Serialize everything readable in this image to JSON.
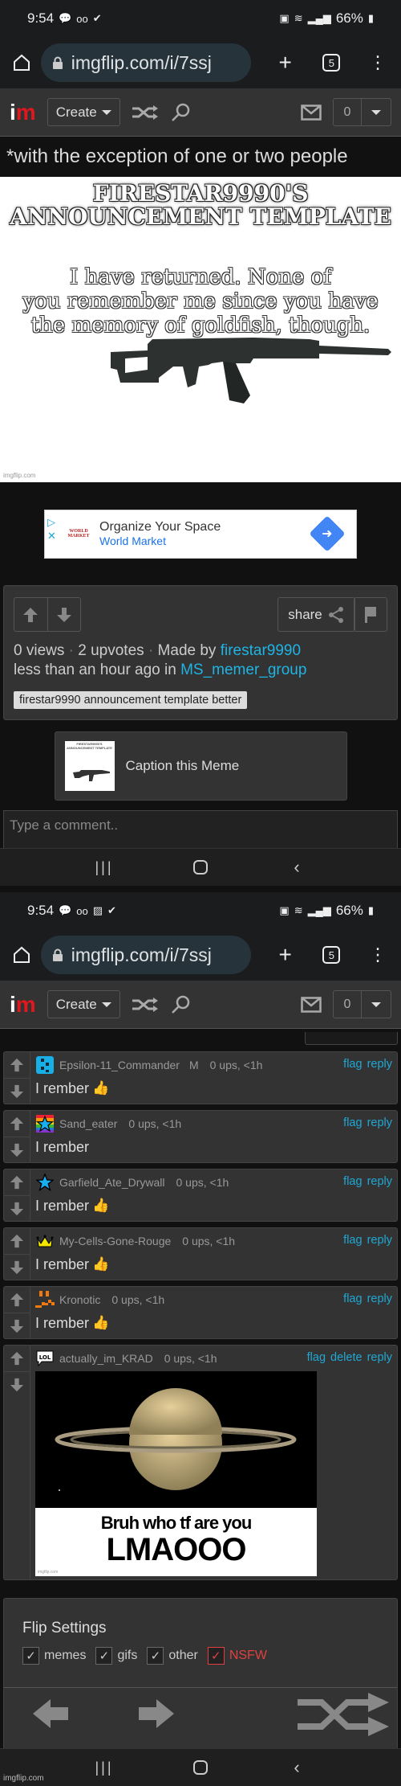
{
  "screens": [
    {
      "status": {
        "time": "9:54",
        "battery": "66%",
        "left_icons": [
          "chat-bubble-icon",
          "voicemail-icon",
          "download-done-icon"
        ]
      },
      "browser": {
        "url": "imgflip.com/i/7ssj",
        "tab_count": "5"
      },
      "header": {
        "create_label": "Create",
        "notification_count": "0"
      }
    },
    {
      "status": {
        "time": "9:54",
        "battery": "66%",
        "left_icons": [
          "chat-bubble-icon",
          "voicemail-icon",
          "image-icon",
          "download-done-icon"
        ]
      },
      "browser": {
        "url": "imgflip.com/i/7ssj",
        "tab_count": "5"
      },
      "header": {
        "create_label": "Create",
        "notification_count": "0"
      }
    }
  ],
  "meme": {
    "caption_overflow": "*with the exception of one or two people",
    "title_line1": "FIRESTAR9990'S",
    "title_line2": "ANNOUNCEMENT TEMPLATE",
    "body_line1": "I have returned. None of",
    "body_line2": "you remember me since you have",
    "body_line3": "the memory of goldfish, though.",
    "watermark": "imgflip.com"
  },
  "ad": {
    "brand": "WORLD MARKET",
    "title": "Organize Your Space",
    "subtitle": "World Market"
  },
  "info": {
    "share_label": "share",
    "views": "0 views",
    "upvotes": "2 upvotes",
    "made_by_prefix": "Made by",
    "author": "firestar9990",
    "time_prefix": "less than an hour ago in",
    "stream": "MS_memer_group",
    "tag": "firestar9990 announcement template better"
  },
  "caption_this": {
    "label": "Caption this Meme",
    "thumb_title": "FIRESTAR9990'S ANNOUNCEMENT TEMPLATE"
  },
  "comment_input": {
    "placeholder": "Type a comment.."
  },
  "comments": [
    {
      "user": "Epsilon-11_Commander",
      "badge": "M",
      "meta": "0 ups, <1h",
      "text": "I rember",
      "emoji": "👍",
      "avatar": "pixel-blue",
      "actions": [
        "flag",
        "reply"
      ]
    },
    {
      "user": "Sand_eater",
      "badge": "",
      "meta": "0 ups, <1h",
      "text": "I rember",
      "emoji": "",
      "avatar": "rainbow-star",
      "actions": [
        "flag",
        "reply"
      ]
    },
    {
      "user": "Garfield_Ate_Drywall",
      "badge": "",
      "meta": "0 ups, <1h",
      "text": "I rember",
      "emoji": "👍",
      "avatar": "blue-star",
      "actions": [
        "flag",
        "reply"
      ]
    },
    {
      "user": "My-Cells-Gone-Rouge",
      "badge": "",
      "meta": "0 ups, <1h",
      "text": "I rember",
      "emoji": "👍",
      "avatar": "crown",
      "actions": [
        "flag",
        "reply"
      ]
    },
    {
      "user": "Kronotic",
      "badge": "",
      "meta": "0 ups, <1h",
      "text": "I rember",
      "emoji": "👍",
      "avatar": "pixel-orange",
      "actions": [
        "flag",
        "reply"
      ]
    },
    {
      "user": "actually_im_KRAD",
      "badge": "",
      "meta": "0 ups, <1h",
      "text": "",
      "emoji": "",
      "avatar": "lol-bubble",
      "actions": [
        "flag",
        "delete",
        "reply"
      ],
      "image": {
        "line1": "Bruh who tf are you",
        "line2": "LMAOOO",
        "watermark": "imgflip.com"
      }
    }
  ],
  "flip_settings": {
    "title": "Flip Settings",
    "options": [
      {
        "label": "memes",
        "checked": true
      },
      {
        "label": "gifs",
        "checked": true
      },
      {
        "label": "other",
        "checked": true
      },
      {
        "label": "NSFW",
        "checked": true
      }
    ]
  },
  "footer_watermark": "imgflip.com",
  "colors": {
    "accent_link": "#1fb4e3",
    "logo_red": "#e1171e",
    "nsfw_red": "#e04040"
  }
}
